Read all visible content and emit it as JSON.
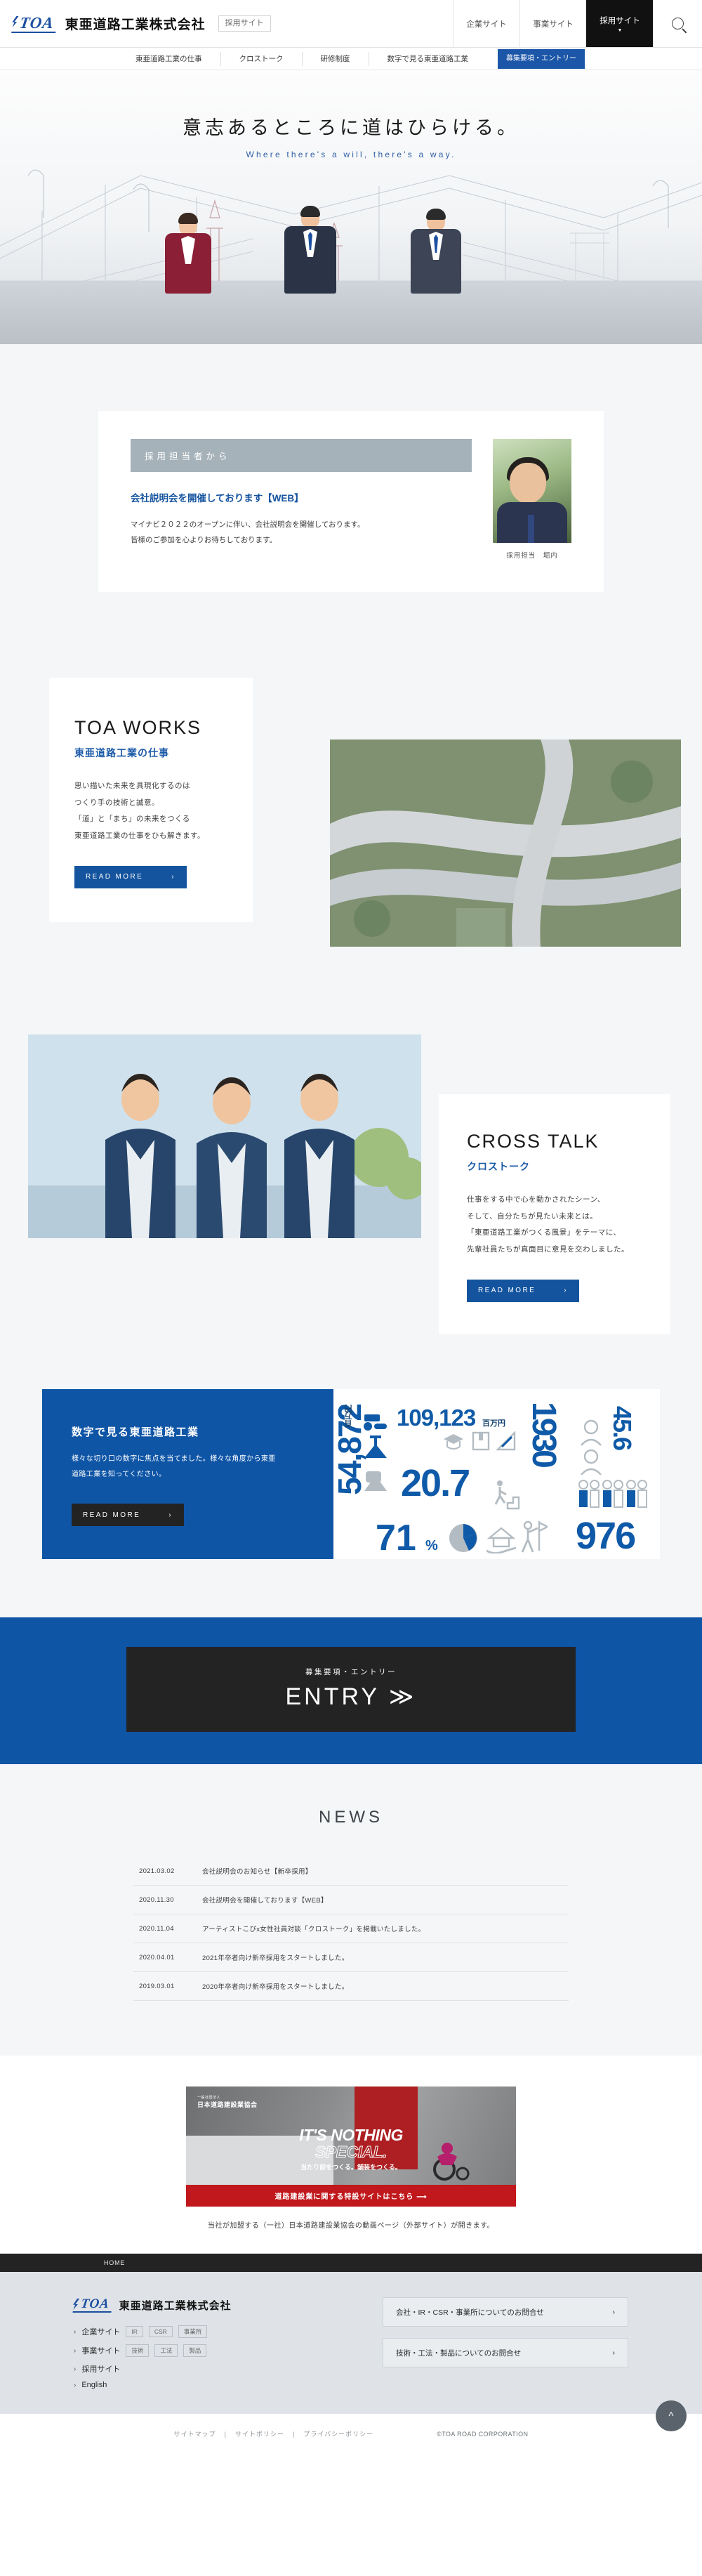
{
  "header": {
    "logo_text": "TOA",
    "company_name": "東亜道路工業株式会社",
    "site_tag": "採用サイト",
    "nav": [
      {
        "label": "企業サイト",
        "active": false
      },
      {
        "label": "事業サイト",
        "active": false
      },
      {
        "label": "採用サイト",
        "active": true
      }
    ],
    "search_icon": "search-icon"
  },
  "subnav": {
    "items": [
      {
        "label": "東亜道路工業の仕事"
      },
      {
        "label": "クロストーク"
      },
      {
        "label": "研修制度"
      },
      {
        "label": "数字で見る東亜道路工業"
      }
    ],
    "cta": "募集要項・エントリー"
  },
  "hero": {
    "headline_jp": "意志あるところに道はひらける。",
    "headline_en": "Where there's a will, there's a way."
  },
  "recruiter": {
    "band_label": "採用担当者から",
    "title": "会社説明会を開催しております【WEB】",
    "line1": "マイナビ２０２２のオープンに伴い、会社説明会を開催しております。",
    "line2": "皆様のご参加を心よりお待ちしております。",
    "photo_caption": "採用担当　堀内"
  },
  "works": {
    "title_en": "TOA WORKS",
    "title_jp": "東亜道路工業の仕事",
    "body_lines": [
      "思い描いた未来を具現化するのは",
      "つくり手の技術と誠意。",
      "「道」と「まち」の未来をつくる",
      "東亜道路工業の仕事をひも解きます。"
    ],
    "read_more": "READ MORE"
  },
  "cross": {
    "title_en": "CROSS TALK",
    "title_jp": "クロストーク",
    "body_lines": [
      "仕事をする中で心を動かされたシーン、",
      "そして、自分たちが見たい未来とは。",
      "「東亜道路工業がつくる風景」をテーマに、",
      "先輩社員たちが真面目に意見を交わしました。"
    ],
    "read_more": "READ MORE"
  },
  "numbers": {
    "title": "数字で見る東亜道路工業",
    "body_lines": [
      "様々な切り口の数字に焦点を当てました。様々な角度から東亜",
      "道路工業を知ってください。"
    ],
    "read_more": "READ MORE",
    "stats": [
      {
        "value": "54,872",
        "unit": "百万円",
        "name": "vertical-revenue"
      },
      {
        "value": "109,123",
        "unit": "百万円",
        "name": "orders"
      },
      {
        "value": "1930",
        "unit": "",
        "name": "founded-year"
      },
      {
        "value": "45.6",
        "unit": "",
        "name": "average-age"
      },
      {
        "value": "20.7",
        "unit": "",
        "name": "years-of-service"
      },
      {
        "value": "71",
        "unit": "%",
        "name": "percent-stat"
      },
      {
        "value": "976",
        "unit": "",
        "name": "employees"
      }
    ]
  },
  "entry": {
    "sub": "募集要項・エントリー",
    "main": "ENTRY ≫"
  },
  "news": {
    "title": "NEWS",
    "items": [
      {
        "date": "2021.03.02",
        "text": "会社説明会のお知らせ【新卒採用】"
      },
      {
        "date": "2020.11.30",
        "text": "会社説明会を開催しております【WEB】"
      },
      {
        "date": "2020.11.04",
        "text": "アーティストこぴx女性社員対談「クロストーク」を掲載いたしました。"
      },
      {
        "date": "2020.04.01",
        "text": "2021年卒者向け新卒採用をスタートしました。"
      },
      {
        "date": "2019.03.01",
        "text": "2020年卒者向け新卒採用をスタートしました。"
      }
    ]
  },
  "banner": {
    "assoc_small": "一般社団法人",
    "assoc_name": "日本道路建設業協会",
    "head_line1": "IT'S NOTHING",
    "head_line2": "SPECIAL.",
    "head_line3": "当たり前をつくる。舗装をつくる。",
    "cta": "道路建設業に関する特設サイトはこちら ⟶",
    "note": "当社が加盟する（一社）日本道路建設業協会の動画ページ（外部サイト）が開きます。"
  },
  "footer": {
    "breadcrumb": "HOME",
    "logo_text": "TOA",
    "company_name": "東亜道路工業株式会社",
    "links": [
      {
        "label": "企業サイト",
        "pills": [
          "IR",
          "CSR",
          "事業所"
        ]
      },
      {
        "label": "事業サイト",
        "pills": [
          "技術",
          "工法",
          "製品"
        ]
      },
      {
        "label": "採用サイト",
        "pills": []
      },
      {
        "label": "English",
        "pills": []
      }
    ],
    "buttons": [
      "会社・IR・CSR・事業所についてのお問合せ",
      "技術・工法・製品についてのお問合せ"
    ],
    "bottom_links": [
      "サイトマップ",
      "サイトポリシー",
      "プライバシーポリシー"
    ],
    "copyright": "©TOA ROAD CORPORATION",
    "to_top_icon": "chevron-up-icon"
  }
}
